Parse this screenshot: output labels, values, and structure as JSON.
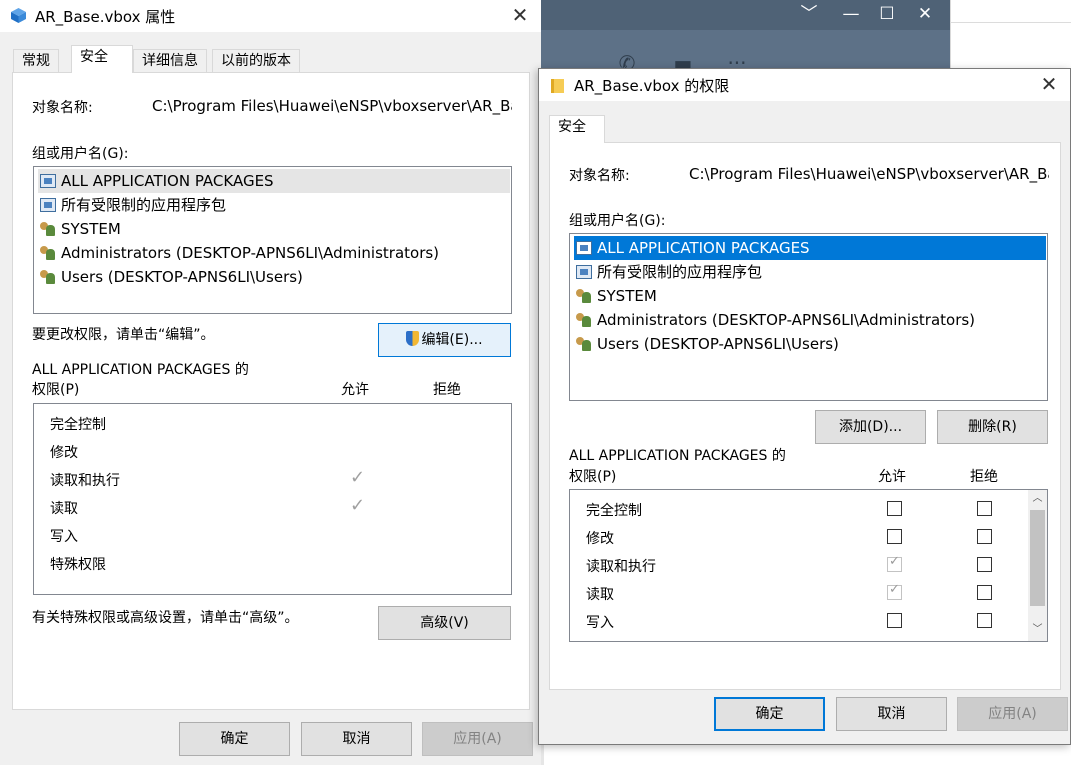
{
  "background_app": {
    "controls": [
      "﹀",
      "—",
      "☐",
      "✕"
    ]
  },
  "props_window": {
    "title": "AR_Base.vbox 属性",
    "close": "✕",
    "tabs": [
      "常规",
      "安全",
      "详细信息",
      "以前的版本"
    ],
    "object_label": "对象名称:",
    "object_path": "C:\\Program Files\\Huawei\\eNSP\\vboxserver\\AR_Ba",
    "groups_label": "组或用户名(G):",
    "groups": [
      {
        "name": "ALL APPLICATION PACKAGES",
        "icon": "package-icon"
      },
      {
        "name": "所有受限制的应用程序包",
        "icon": "package-icon"
      },
      {
        "name": "SYSTEM",
        "icon": "user-group-icon"
      },
      {
        "name": "Administrators (DESKTOP-APNS6LI\\Administrators)",
        "icon": "user-group-icon"
      },
      {
        "name": "Users (DESKTOP-APNS6LI\\Users)",
        "icon": "user-group-icon"
      }
    ],
    "edit_hint": "要更改权限，请单击“编辑”。",
    "edit_button": "编辑(E)...",
    "perm_title_line1": "ALL APPLICATION PACKAGES 的",
    "perm_title_line2": "权限(P)",
    "allow_header": "允许",
    "deny_header": "拒绝",
    "permissions": [
      {
        "name": "完全控制",
        "allow": false
      },
      {
        "name": "修改",
        "allow": false
      },
      {
        "name": "读取和执行",
        "allow": true
      },
      {
        "name": "读取",
        "allow": true
      },
      {
        "name": "写入",
        "allow": false
      },
      {
        "name": "特殊权限",
        "allow": false
      }
    ],
    "check_glyph": "✓",
    "advanced_hint": "有关特殊权限或高级设置，请单击“高级”。",
    "advanced_button": "高级(V)",
    "ok": "确定",
    "cancel": "取消",
    "apply": "应用(A)"
  },
  "perm_window": {
    "title": "AR_Base.vbox 的权限",
    "close": "✕",
    "tab": "安全",
    "object_label": "对象名称:",
    "object_path": "C:\\Program Files\\Huawei\\eNSP\\vboxserver\\AR_Ba",
    "groups_label": "组或用户名(G):",
    "groups": [
      {
        "name": "ALL APPLICATION PACKAGES",
        "icon": "package-icon"
      },
      {
        "name": "所有受限制的应用程序包",
        "icon": "package-icon"
      },
      {
        "name": "SYSTEM",
        "icon": "user-group-icon"
      },
      {
        "name": "Administrators (DESKTOP-APNS6LI\\Administrators)",
        "icon": "user-group-icon"
      },
      {
        "name": "Users (DESKTOP-APNS6LI\\Users)",
        "icon": "user-group-icon"
      }
    ],
    "add_button": "添加(D)...",
    "remove_button": "删除(R)",
    "perm_title_line1": "ALL APPLICATION PACKAGES 的",
    "perm_title_line2": "权限(P)",
    "allow_header": "允许",
    "deny_header": "拒绝",
    "permissions": [
      {
        "name": "完全控制",
        "allow": false,
        "deny": false
      },
      {
        "name": "修改",
        "allow": false,
        "deny": false
      },
      {
        "name": "读取和执行",
        "allow": true,
        "deny": false
      },
      {
        "name": "读取",
        "allow": true,
        "deny": false
      },
      {
        "name": "写入",
        "allow": false,
        "deny": false
      }
    ],
    "scroll_up": "︿",
    "scroll_down": "﹀",
    "ok": "确定",
    "cancel": "取消",
    "apply": "应用(A)"
  }
}
